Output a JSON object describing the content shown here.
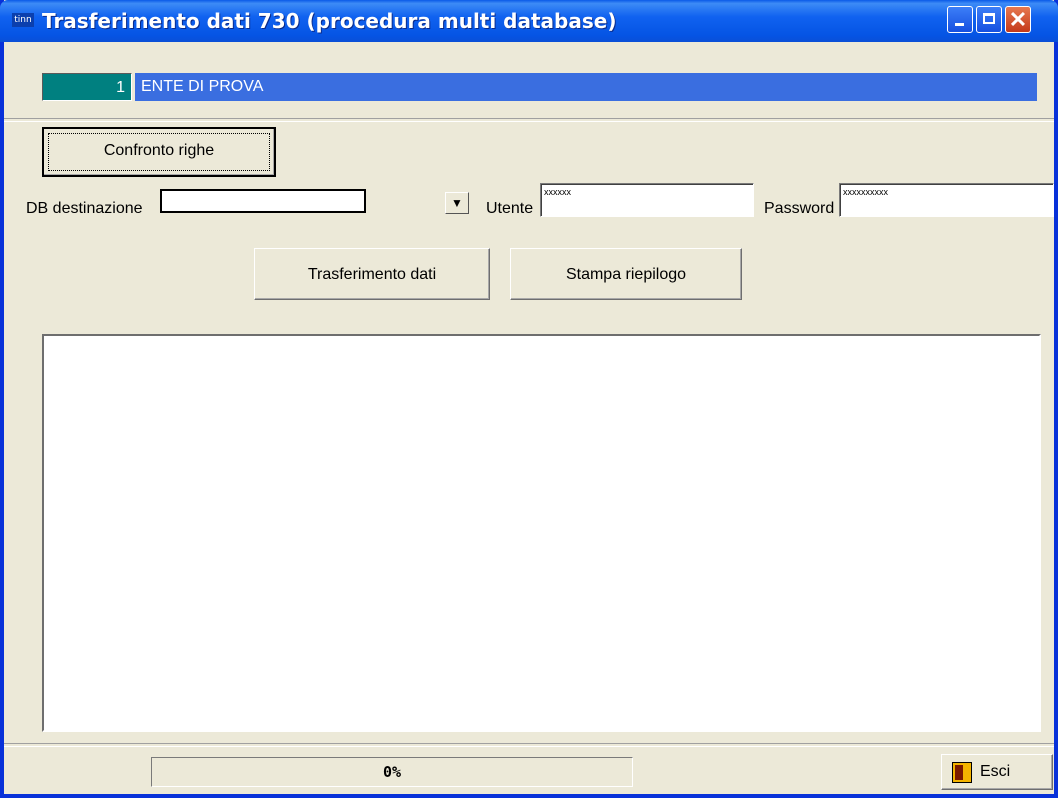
{
  "window": {
    "title": "Trasferimento dati 730 (procedura multi database)",
    "icon_label": "tinn"
  },
  "ente": {
    "code": "1",
    "name": "ENTE DI PROVA"
  },
  "buttons": {
    "confronto": "Confronto righe",
    "trasferimento": "Trasferimento dati",
    "stampa": "Stampa riepilogo",
    "esci": "Esci"
  },
  "form": {
    "db_label": "DB destinazione",
    "db_value": "",
    "utente_label": "Utente",
    "utente_value": "xxxxxx",
    "password_label": "Password",
    "password_value": "xxxxxxxxxx"
  },
  "progress": {
    "percent": 0,
    "label": "0%"
  },
  "icons": [
    "app-icon",
    "minimize-icon",
    "maximize-icon",
    "close-icon",
    "dropdown-arrow-icon",
    "exit-door-icon"
  ]
}
